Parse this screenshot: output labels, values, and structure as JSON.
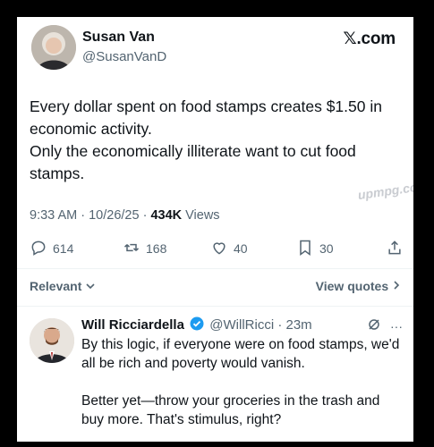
{
  "post": {
    "author_name": "Susan Van",
    "author_handle": "@SusanVanD",
    "brand": "𝕏.com",
    "text": "Every dollar spent on food stamps creates $1.50 in economic activity.\nOnly the economically illiterate want to cut food stamps.",
    "time": "9:33 AM",
    "date": "10/26/25",
    "views_count": "434K",
    "views_label": "Views",
    "watermark": "upmpg.com"
  },
  "actions": {
    "replies": "614",
    "reposts": "168",
    "likes": "40",
    "bookmarks": "30"
  },
  "replies_bar": {
    "sort_label": "Relevant",
    "quotes_label": "View quotes"
  },
  "reply": {
    "author_name": "Will Ricciardella",
    "author_handle": "@WillRicci",
    "time": "23m",
    "text": "By this logic, if everyone were on food stamps, we'd all be rich and poverty would vanish.\n\nBetter yet—throw your groceries in the trash and buy more. That's stimulus, right?"
  },
  "colors": {
    "secondary_text": "#536471",
    "verified": "#1d9bf0",
    "background": "#ffffff",
    "frame": "#000000"
  },
  "icons": [
    "reply-icon",
    "repost-icon",
    "like-icon",
    "bookmark-icon",
    "share-icon",
    "chevron-down-icon",
    "chevron-right-icon",
    "verified-icon",
    "grok-icon",
    "more-icon"
  ]
}
